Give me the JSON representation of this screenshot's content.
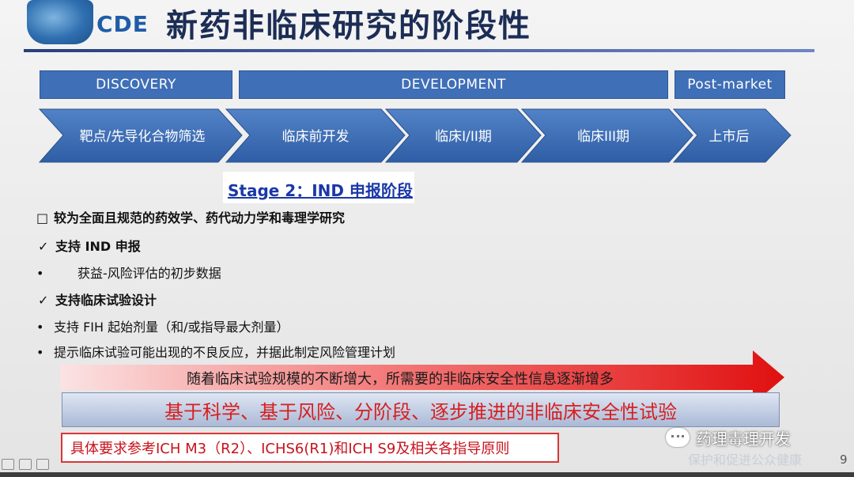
{
  "header": {
    "logo_text": "CDE",
    "title": "新药非临床研究的阶段性"
  },
  "phases": [
    {
      "label": "DISCOVERY"
    },
    {
      "label": "DEVELOPMENT"
    },
    {
      "label": "Post-market"
    }
  ],
  "stages": [
    {
      "label": "靶点/先导化合物筛选"
    },
    {
      "label": "临床前开发"
    },
    {
      "label": "临床I/II期"
    },
    {
      "label": "临床III期"
    },
    {
      "label": "上市后"
    }
  ],
  "stage_heading": "Stage 2：IND 申报阶段",
  "content": {
    "main_point": "较为全面且规范的药效学、药代动力学和毒理学研究",
    "check1": "支持 IND 申报",
    "bullet1": "获益-风险评估的初步数据",
    "check2": "支持临床试验设计",
    "bullet2": "支持 FIH 起始剂量（和/或指导最大剂量）",
    "bullet3": "提示临床试验可能出现的不良反应，并据此制定风险管理计划"
  },
  "arrow_text": "随着临床试验规模的不断增大，所需要的非临床安全性信息逐渐增多",
  "principle_text": "基于科学、基于风险、分阶段、逐步推进的非临床安全性试验",
  "reference_text": "具体要求参考ICH M3（R2）、ICHS6(R1)和ICH S9及相关各指导原则",
  "watermark": {
    "name": "药理毒理开发",
    "faded_text": "保护和促进公众健康"
  },
  "page_number": "9",
  "colors": {
    "phase_bar": "#3f6fb6",
    "chevron": "#3e6db3",
    "title": "#1c2d55",
    "emphasis_red": "#d62020"
  }
}
